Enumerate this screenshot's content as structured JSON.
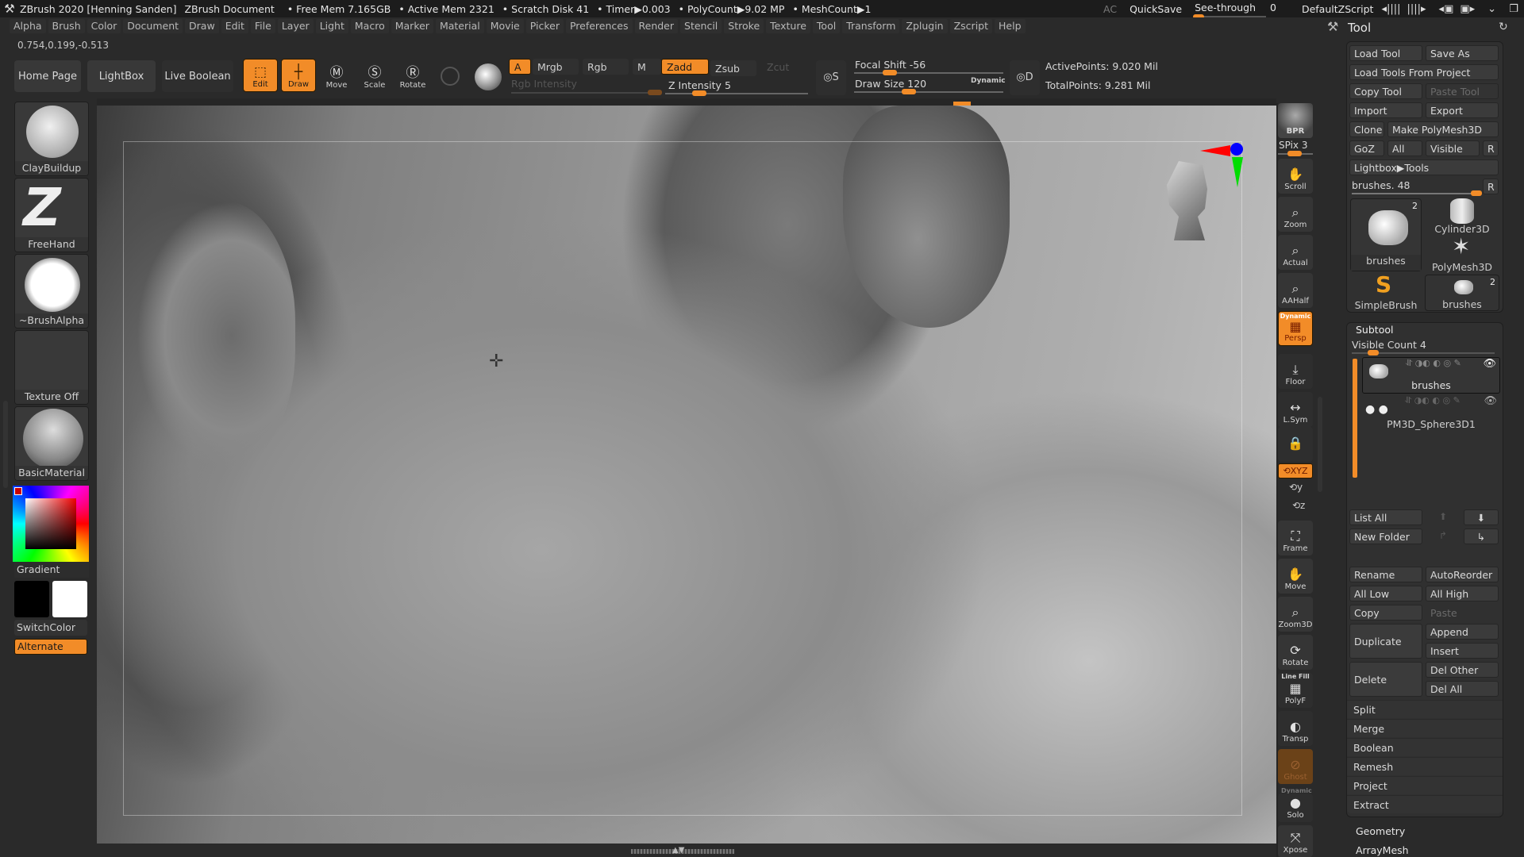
{
  "titlebar": {
    "app": "ZBrush 2020 [Henning Sanden]",
    "document": "ZBrush Document",
    "free_mem": "• Free Mem 7.165GB",
    "active_mem": "• Active Mem 2321",
    "scratch_disk": "• Scratch Disk 41",
    "timer": "• Timer▶0.003",
    "polycount": "• PolyCount▶9.02 MP",
    "meshcount": "• MeshCount▶1",
    "ac": "AC",
    "quicksave": "QuickSave",
    "see_through_label": "See-through",
    "see_through_value": "0",
    "default_zscript": "DefaultZScript",
    "see_through_fraction": 0.0
  },
  "menu": [
    "Alpha",
    "Brush",
    "Color",
    "Document",
    "Draw",
    "Edit",
    "File",
    "Layer",
    "Light",
    "Macro",
    "Marker",
    "Material",
    "Movie",
    "Picker",
    "Preferences",
    "Render",
    "Stencil",
    "Stroke",
    "Texture",
    "Tool",
    "Transform",
    "Zplugin",
    "Zscript",
    "Help"
  ],
  "coords": "0.754,0.199,-0.513",
  "toolbar": {
    "home_page": "Home Page",
    "lightbox": "LightBox",
    "live_boolean": "Live Boolean",
    "edit": "Edit",
    "draw": "Draw",
    "move": "Move",
    "scale": "Scale",
    "rotate": "Rotate",
    "a": "A",
    "mrgb": "Mrgb",
    "rgb": "Rgb",
    "m": "M",
    "zadd": "Zadd",
    "zsub": "Zsub",
    "zcut": "Zcut",
    "rgb_intensity": "Rgb Intensity",
    "z_intensity_label": "Z Intensity",
    "z_intensity": "5",
    "focal_shift_label": "Focal Shift",
    "focal_shift": "-56",
    "draw_size_label": "Draw Size",
    "draw_size": "120",
    "dynamic": "Dynamic",
    "s": "S",
    "d": "D",
    "active_points": "ActivePoints: 9.020 Mil",
    "total_points": "TotalPoints: 9.281 Mil"
  },
  "left_shelf": {
    "brush": "ClayBuildup",
    "stroke": "FreeHand",
    "alpha": "~BrushAlpha",
    "texture": "Texture Off",
    "material": "BasicMaterial",
    "gradient": "Gradient",
    "switch_color": "SwitchColor",
    "alternate": "Alternate",
    "main_color": "#000000",
    "secondary_color": "#ffffff"
  },
  "right_shelf": {
    "bpr": "BPR",
    "spix": "SPix 3",
    "scroll": "Scroll",
    "zoom": "Zoom",
    "actual": "Actual",
    "aahalf": "AAHalf",
    "dynamic": "Dynamic",
    "persp": "Persp",
    "floor": "Floor",
    "lsym": "L.Sym",
    "xyz": "XYZ",
    "frame": "Frame",
    "move": "Move",
    "zoom3d": "Zoom3D",
    "rotate": "Rotate",
    "line_fill": "Line Fill",
    "polyf": "PolyF",
    "transp": "Transp",
    "ghost": "Ghost",
    "dynamic2": "Dynamic",
    "solo": "Solo",
    "xpose": "Xpose"
  },
  "tool_panel": {
    "title": "Tool",
    "load_tool": "Load Tool",
    "save_as": "Save As",
    "load_tools_from_project": "Load Tools From Project",
    "copy_tool": "Copy Tool",
    "paste_tool": "Paste Tool",
    "import": "Import",
    "export": "Export",
    "clone": "Clone",
    "make_polymesh": "Make PolyMesh3D",
    "goz": "GoZ",
    "all": "All",
    "visible": "Visible",
    "r": "R",
    "lightbox_tools": "Lightbox▶Tools",
    "brushes_slider": "brushes. 48",
    "thumbs": [
      {
        "name": "brushes",
        "count": "2"
      },
      {
        "name": "Cylinder3D",
        "count": ""
      },
      {
        "name": "PolyMesh3D",
        "count": ""
      },
      {
        "name": "SimpleBrush",
        "count": ""
      },
      {
        "name": "brushes",
        "count": "2"
      }
    ],
    "subtool": {
      "title": "Subtool",
      "visible_count": "Visible Count 4",
      "items": [
        {
          "name": "brushes",
          "selected": true
        },
        {
          "name": "PM3D_Sphere3D1",
          "selected": false
        }
      ],
      "list_all": "List All",
      "new_folder": "New Folder",
      "rename": "Rename",
      "autoreorder": "AutoReorder",
      "all_low": "All Low",
      "all_high": "All High",
      "copy": "Copy",
      "paste": "Paste",
      "duplicate": "Duplicate",
      "append": "Append",
      "insert": "Insert",
      "delete": "Delete",
      "del_other": "Del Other",
      "del_all": "Del All",
      "sections": [
        "Split",
        "Merge",
        "Boolean",
        "Remesh",
        "Project",
        "Extract"
      ]
    },
    "geometry": "Geometry",
    "arraymesh": "ArrayMesh"
  }
}
